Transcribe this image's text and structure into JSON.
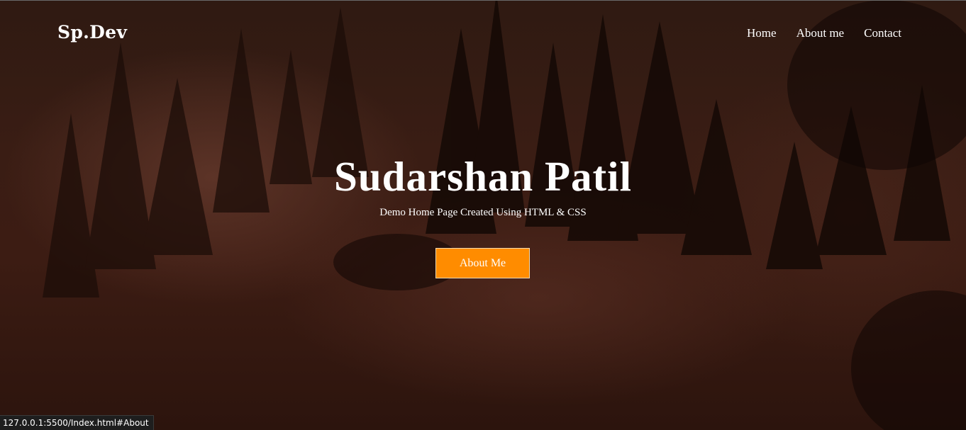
{
  "header": {
    "logo": "Sp.Dev",
    "nav": [
      {
        "label": "Home"
      },
      {
        "label": "About me"
      },
      {
        "label": "Contact"
      }
    ]
  },
  "hero": {
    "title": "Sudarshan Patil",
    "subtitle": "Demo Home Page Created Using HTML & CSS",
    "button_label": "About Me",
    "background": "misty-forest-image",
    "overlay_color": "#3a1d14"
  },
  "colors": {
    "accent": "#ff8c00",
    "text": "#ffffff"
  },
  "status_bar": {
    "url": "127.0.0.1:5500/Index.html#About"
  }
}
